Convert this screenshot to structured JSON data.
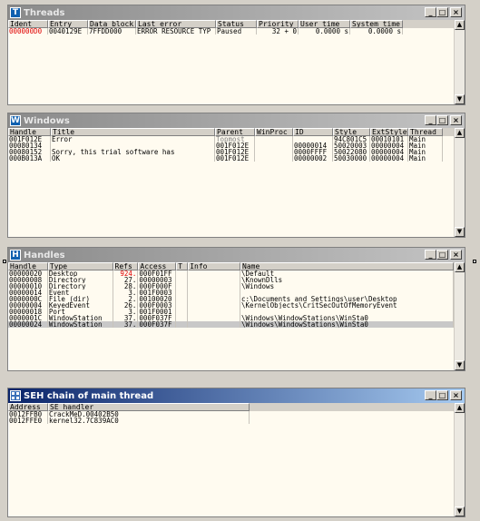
{
  "threads": {
    "title": "Threads",
    "icon": "T",
    "columns": [
      "Ident",
      "Entry",
      "Data block",
      "Last error",
      "Status",
      "Priority",
      "User time",
      "System time"
    ],
    "rows": [
      [
        "000000D0",
        "0040129E",
        "7FFDD000",
        "ERROR_RESOURCE_TYP",
        "Paused",
        "32 + 0",
        "0.0000 s",
        "0.0000 s"
      ]
    ]
  },
  "windows": {
    "title": "Windows",
    "icon": "W",
    "columns": [
      "Handle",
      "Title",
      "Parent",
      "WinProc",
      "ID",
      "Style",
      "ExtStyle",
      "Thread"
    ],
    "rows": [
      [
        "001F012E",
        "Error",
        "Topmost",
        "",
        "",
        "94C801C5",
        "00010101",
        "Main"
      ],
      [
        "00080134",
        "",
        "001F012E",
        "",
        "00000014",
        "50020003",
        "00000004",
        "Main"
      ],
      [
        "00080152",
        "Sorry, this trial software has",
        "001F012E",
        "",
        "0000FFFF",
        "50022080",
        "00000004",
        "Main"
      ],
      [
        "000B013A",
        "OK",
        "001F012E",
        "",
        "00000002",
        "50030000",
        "00000004",
        "Main"
      ]
    ]
  },
  "handles": {
    "title": "Handles",
    "icon": "H",
    "columns": [
      "Handle",
      "Type",
      "Refs",
      "Access",
      "T",
      "Info",
      "Name"
    ],
    "rows": [
      [
        "00000020",
        "Desktop",
        "924.",
        "000F01FF",
        "",
        "",
        "\\Default"
      ],
      [
        "00000008",
        "Directory",
        "27.",
        "00000003",
        "",
        "",
        "\\KnownDlls"
      ],
      [
        "00000010",
        "Directory",
        "28.",
        "000F000F",
        "",
        "",
        "\\Windows"
      ],
      [
        "00000014",
        "Event",
        "3.",
        "001F0003",
        "",
        "",
        ""
      ],
      [
        "0000000C",
        "File (dir)",
        "2.",
        "00100020",
        "",
        "",
        "c:\\Documents and Settings\\user\\Desktop"
      ],
      [
        "00000004",
        "KeyedEvent",
        "26.",
        "000F0003",
        "",
        "",
        "\\KernelObjects\\CritSecOutOfMemoryEvent"
      ],
      [
        "00000018",
        "Port",
        "3.",
        "001F0001",
        "",
        "",
        ""
      ],
      [
        "0000001C",
        "WindowStation",
        "37.",
        "000F037F",
        "",
        "",
        "\\Windows\\WindowStations\\WinSta0"
      ],
      [
        "00000024",
        "WindowStation",
        "37.",
        "000F037F",
        "",
        "",
        "\\Windows\\WindowStations\\WinSta0"
      ]
    ]
  },
  "seh": {
    "title": "SEH chain of main thread",
    "columns": [
      "Address",
      "SE handler"
    ],
    "rows": [
      [
        "0012FFB0",
        "CrackMeD.00402B50"
      ],
      [
        "0012FFE0",
        "kernel32.7C839AC0"
      ]
    ]
  },
  "buttons": {
    "minimize": "_",
    "maximize": "□",
    "close": "×",
    "up": "▲",
    "down": "▼"
  }
}
